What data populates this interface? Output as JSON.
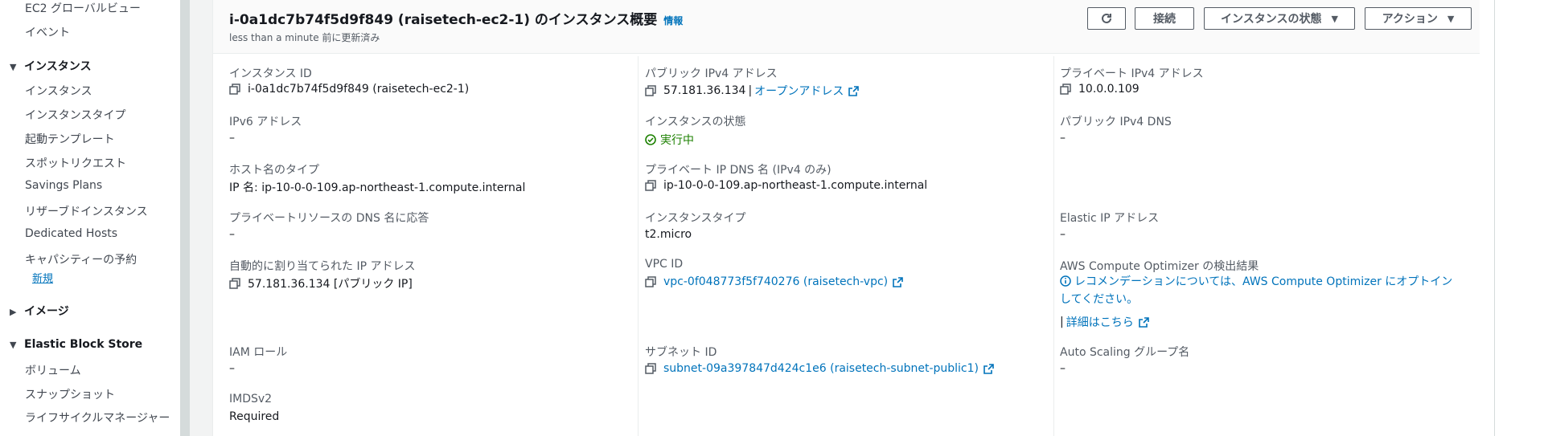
{
  "sidebar": {
    "items_top": [
      "EC2 グローバルビュー",
      "イベント"
    ],
    "section_instances": "インスタンス",
    "instances_items": [
      "インスタンス",
      "インスタンスタイプ",
      "起動テンプレート",
      "スポットリクエスト",
      "Savings Plans",
      "リザーブドインスタンス",
      "Dedicated Hosts",
      "キャパシティーの予約"
    ],
    "new_badge": "新規",
    "section_images": "イメージ",
    "section_ebs": "Elastic Block Store",
    "ebs_items": [
      "ボリューム",
      "スナップショット",
      "ライフサイクルマネージャー"
    ]
  },
  "header": {
    "title": "i-0a1dc7b74f5d9f849 (raisetech-ec2-1) のインスタンス概要",
    "info": "情報",
    "updated": "less than a minute 前に更新済み",
    "connect": "接続",
    "instance_state": "インスタンスの状態",
    "actions": "アクション"
  },
  "col1": {
    "instance_id_label": "インスタンス ID",
    "instance_id": "i-0a1dc7b74f5d9f849 (raisetech-ec2-1)",
    "ipv6_label": "IPv6 アドレス",
    "ipv6": "–",
    "hostname_type_label": "ホスト名のタイプ",
    "hostname_type": "IP 名: ip-10-0-0-109.ap-northeast-1.compute.internal",
    "private_dns_answer_label": "プライベートリソースの DNS 名に応答",
    "private_dns_answer": "–",
    "auto_ip_label": "自動的に割り当てられた IP アドレス",
    "auto_ip": "57.181.36.134 [パブリック IP]",
    "iam_label": "IAM ロール",
    "iam": "–",
    "imds_label": "IMDSv2",
    "imds": "Required"
  },
  "col2": {
    "public_ipv4_label": "パブリック IPv4 アドレス",
    "public_ipv4": "57.181.36.134",
    "open_address": "オープンアドレス",
    "state_label": "インスタンスの状態",
    "state": "実行中",
    "private_dns_label": "プライベート IP DNS 名 (IPv4 のみ)",
    "private_dns": "ip-10-0-0-109.ap-northeast-1.compute.internal",
    "type_label": "インスタンスタイプ",
    "type": "t2.micro",
    "vpc_label": "VPC ID",
    "vpc": "vpc-0f048773f5f740276 (raisetech-vpc)",
    "subnet_label": "サブネット ID",
    "subnet": "subnet-09a397847d424c1e6 (raisetech-subnet-public1)"
  },
  "col3": {
    "private_ipv4_label": "プライベート IPv4 アドレス",
    "private_ipv4": "10.0.0.109",
    "public_dns_label": "パブリック IPv4 DNS",
    "public_dns": "–",
    "eip_label": "Elastic IP アドレス",
    "eip": "–",
    "optimizer_label": "AWS Compute Optimizer の検出結果",
    "optimizer_text": "レコメンデーションについては、AWS Compute Optimizer にオプトインしてください。",
    "details_link": "詳細はこちら",
    "asg_label": "Auto Scaling グループ名",
    "asg": "–"
  },
  "colors": {
    "link": "#0073bb",
    "running": "#1d8102",
    "text": "#16191f",
    "label": "#545b64"
  }
}
